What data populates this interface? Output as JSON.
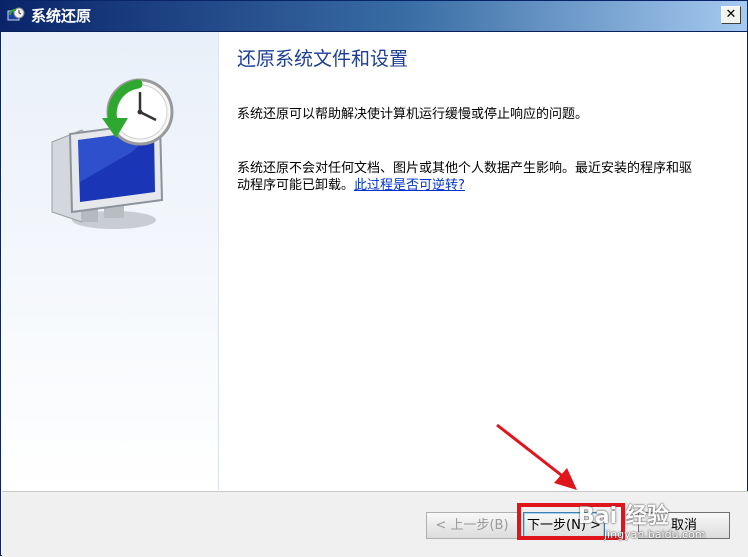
{
  "window": {
    "title": "系统还原",
    "close_glyph": "✕",
    "title_icon": "system-restore-icon"
  },
  "sidebar": {
    "illustration": "monitor-clock-restore-icon"
  },
  "content": {
    "heading": "还原系统文件和设置",
    "paragraph1": "系统还原可以帮助解决使计算机运行缓慢或停止响应的问题。",
    "paragraph2": "系统还原不会对任何文档、图片或其他个人数据产生影响。最近安装的程序和驱动程序可能已卸载。",
    "link": "此过程是否可逆转?"
  },
  "buttons": {
    "back": "< 上一步(B)",
    "next": "下一步(N) >",
    "cancel": "取消"
  },
  "annotations": {
    "highlight_color": "#e0151c",
    "arrow_color": "#e0151c"
  },
  "watermark": {
    "main": "Bai 经验",
    "sub": "jingyan.baidu.com"
  }
}
